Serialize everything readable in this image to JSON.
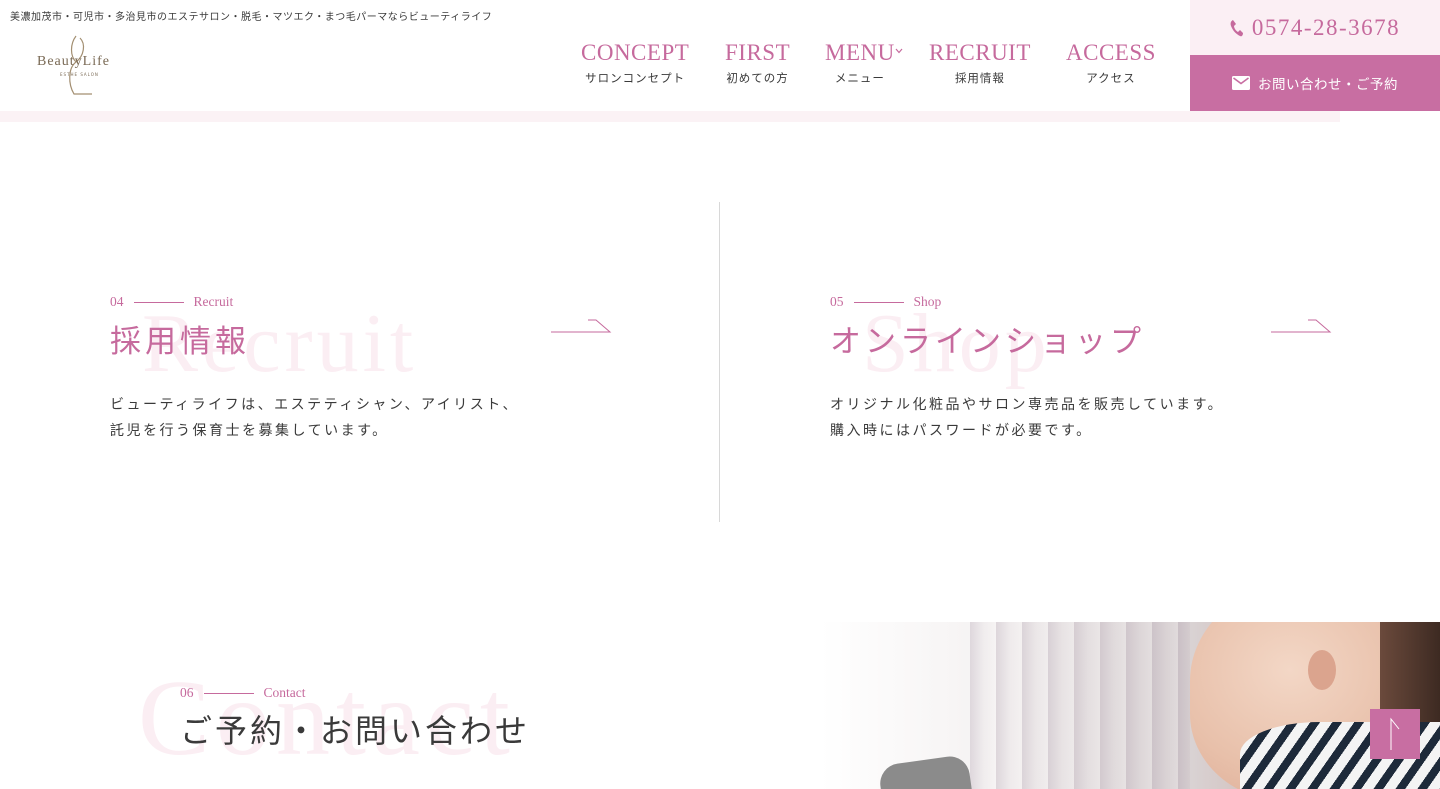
{
  "header": {
    "tagline": "美濃加茂市・可児市・多治見市のエステサロン・脱毛・マツエク・まつ毛パーマならビューティライフ",
    "logo_text": "BeautyLife",
    "logo_sub": "ESTHE SALON",
    "nav": [
      {
        "en": "CONCEPT",
        "jp": "サロンコンセプト"
      },
      {
        "en": "FIRST",
        "jp": "初めての方"
      },
      {
        "en": "MENU",
        "jp": "メニュー"
      },
      {
        "en": "RECRUIT",
        "jp": "採用情報"
      },
      {
        "en": "ACCESS",
        "jp": "アクセス"
      }
    ],
    "phone": "0574-28-3678",
    "contact_button": "お問い合わせ・ご予約",
    "icons": [
      "phone-icon",
      "mail-icon",
      "chevron-down-icon"
    ]
  },
  "cards": [
    {
      "number": "04",
      "label": "Recruit",
      "bg_word": "Recruit",
      "title": "採用情報",
      "desc_line1": "ビューティライフは、エステティシャン、アイリスト、",
      "desc_line2": "託児を行う保育士を募集しています。"
    },
    {
      "number": "05",
      "label": "Shop",
      "bg_word": "Shop",
      "title": "オンラインショップ",
      "desc_line1": "オリジナル化粧品やサロン専売品を販売しています。",
      "desc_line2": "購入時にはパスワードが必要です。"
    }
  ],
  "contact": {
    "number": "06",
    "label": "Contact",
    "bg_word": "Contact",
    "title": "ご予約・お問い合わせ"
  },
  "colors": {
    "accent": "#c66a9d",
    "button": "#c86ea2",
    "soft_pink": "#fbeff4",
    "text": "#3a3a3a"
  }
}
